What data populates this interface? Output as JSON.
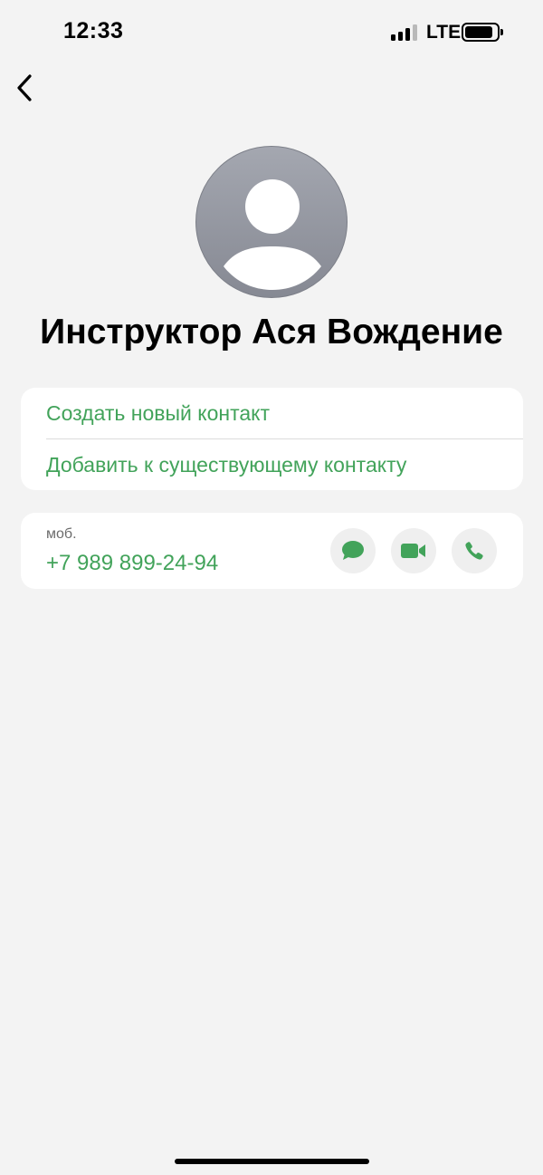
{
  "status_bar": {
    "time": "12:33",
    "network": "LTE",
    "signal_bars_active": 3,
    "signal_bars_total": 4
  },
  "nav": {
    "back_icon": "chevron-left-icon"
  },
  "contact": {
    "name": "Инструктор Ася Вождение",
    "avatar_icon": "person-silhouette-icon"
  },
  "actions": {
    "create_new": "Создать новый контакт",
    "add_existing": "Добавить к существующему контакту"
  },
  "phone": {
    "label": "моб.",
    "number": "+7 989 899-24-94",
    "buttons": [
      "message-icon",
      "video-icon",
      "phone-icon"
    ]
  },
  "colors": {
    "accent": "#42a35a",
    "background": "#f3f3f3"
  }
}
